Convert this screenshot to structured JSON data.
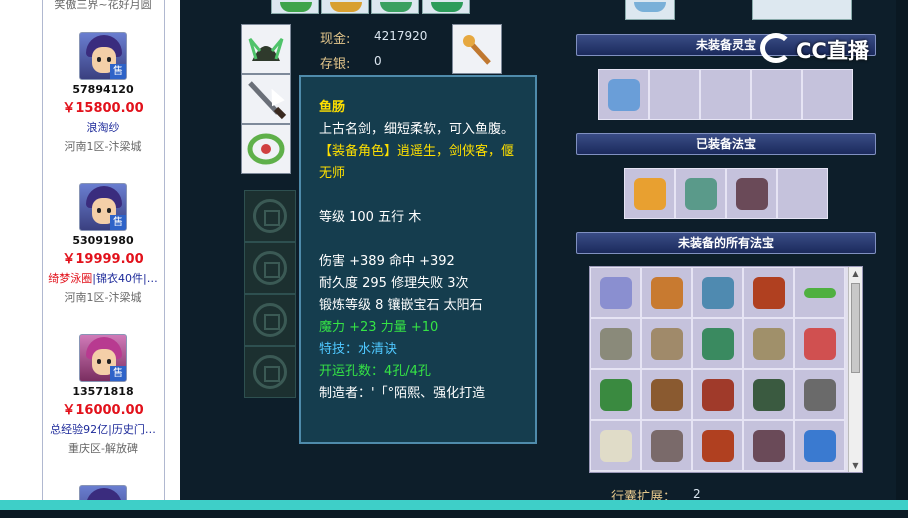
{
  "listing": {
    "top_text": "笑傲三界~花好月圆",
    "badge": "售",
    "items": [
      {
        "id": "57894120",
        "price": "￥15800.00",
        "name_parts": [
          {
            "text": "浪淘纱",
            "color": "blue"
          }
        ],
        "server": "河南1区-汴梁城"
      },
      {
        "id": "53091980",
        "price": "￥19999.00",
        "name_parts": [
          {
            "text": "绮梦泳圈",
            "color": "red"
          },
          {
            "text": "|锦衣40件|…",
            "color": "blue"
          }
        ],
        "server": "河南1区-汴梁城"
      },
      {
        "id": "13571818",
        "price": "￥16000.00",
        "name_parts": [
          {
            "text": "总经验92亿|历史门…",
            "color": "blue"
          }
        ],
        "server": "重庆区-解放碑"
      }
    ]
  },
  "money": {
    "cash_label": "现金:",
    "cash_value": "4217920",
    "deposit_label": "存银:",
    "deposit_value": "0"
  },
  "tooltip": {
    "name": "鱼肠",
    "desc": "上古名剑，细短柔软，可入鱼腹。",
    "role": "【装备角色】逍遥生，剑侠客，偃无师",
    "level": "等级 100 五行 木",
    "damage": "伤害 +389 命中 +392",
    "durability": "耐久度 295 修理失败 3次",
    "forge": "锻炼等级 8 镶嵌宝石 太阳石",
    "magic": "魔力 +23 力量 +10",
    "skill": "特技：水清诀",
    "holes": "开运孔数：4孔/4孔",
    "maker": "制造者：'「°陌熙、强化打造"
  },
  "sections": {
    "unequipped_spirit": "未装备灵宝",
    "equipped_treasure": "已装备法宝",
    "all_unequipped_treasure": "未装备的所有法宝"
  },
  "bag": {
    "expand_label": "行囊扩展：",
    "expand_value": "2"
  },
  "logo": {
    "text": "CC直播"
  },
  "colors": {
    "accent_gold": "#e4c78c",
    "tooltip_yellow": "#ffe000",
    "tooltip_green": "#35e445",
    "price_red": "#e2111b"
  }
}
